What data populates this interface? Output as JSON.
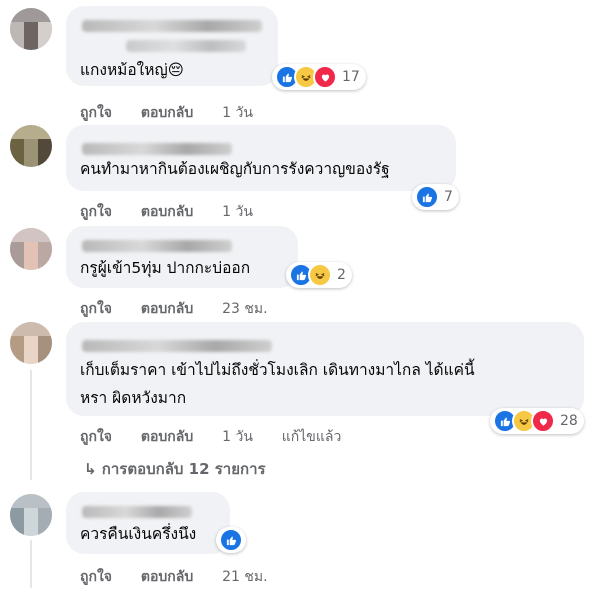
{
  "comments": [
    {
      "text_lines": [
        "แกงหม้อใหญ่😔"
      ],
      "reaction_count": "17",
      "actions": {
        "like": "ถูกใจ",
        "reply": "ตอบกลับ",
        "time": "1 วัน"
      }
    },
    {
      "text_lines": [
        "คนทำมาหากินต้องเผชิญกับการรังควาญของรัฐ"
      ],
      "reaction_count": "7",
      "actions": {
        "like": "ถูกใจ",
        "reply": "ตอบกลับ",
        "time": "1 วัน"
      }
    },
    {
      "text_lines": [
        "กรูผู้เข้า5ทุ่ม ปากกะบ่ออก"
      ],
      "reaction_count": "2",
      "actions": {
        "like": "ถูกใจ",
        "reply": "ตอบกลับ",
        "time": "23 ชม."
      }
    },
    {
      "text_lines": [
        "เก็บเต็มราคา เข้าไปไม่ถึงชั่วโมงเลิก เดินทางมาไกล ได้แค่นี้",
        "หรา ผิดหวังมาก"
      ],
      "reaction_count": "28",
      "actions": {
        "like": "ถูกใจ",
        "reply": "ตอบกลับ",
        "time": "1 วัน",
        "edited": "แก้ไขแล้ว"
      }
    },
    {
      "text_lines": [
        "ควรคืนเงินครึ่งนึง"
      ],
      "reaction_count": "",
      "actions": {
        "like": "ถูกใจ",
        "reply": "ตอบกลับ",
        "time": "21 ชม."
      }
    }
  ],
  "replies_link": "↳ การตอบกลับ 12 รายการ",
  "icons": {
    "like": "like-reaction-icon",
    "haha": "haha-reaction-icon",
    "love": "love-reaction-icon"
  },
  "colors": {
    "like": "#1b74e4",
    "haha": "#f7c844",
    "love": "#f0284a",
    "bubble": "#f0f2f5",
    "meta": "#65676b"
  }
}
